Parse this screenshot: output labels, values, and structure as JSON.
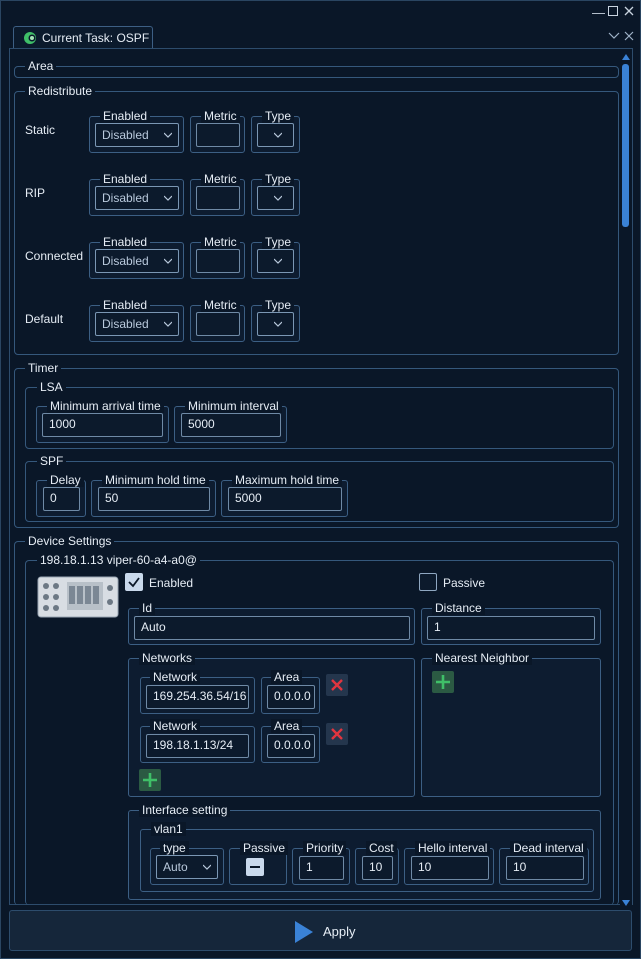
{
  "window": {
    "tab_title": "Current Task: OSPF"
  },
  "area": {
    "legend": "Area"
  },
  "redistribute": {
    "legend": "Redistribute",
    "col_enabled": "Enabled",
    "col_metric": "Metric",
    "col_type": "Type",
    "rows": [
      {
        "label": "Static",
        "enabled": "Disabled",
        "metric": "",
        "type": ""
      },
      {
        "label": "RIP",
        "enabled": "Disabled",
        "metric": "",
        "type": ""
      },
      {
        "label": "Connected",
        "enabled": "Disabled",
        "metric": "",
        "type": ""
      },
      {
        "label": "Default",
        "enabled": "Disabled",
        "metric": "",
        "type": ""
      }
    ]
  },
  "timer": {
    "legend": "Timer",
    "lsa": {
      "legend": "LSA",
      "min_arrival_label": "Minimum arrival time",
      "min_arrival_value": "1000",
      "min_interval_label": "Minimum interval",
      "min_interval_value": "5000"
    },
    "spf": {
      "legend": "SPF",
      "delay_label": "Delay",
      "delay_value": "0",
      "min_hold_label": "Minimum hold time",
      "min_hold_value": "50",
      "max_hold_label": "Maximum hold time",
      "max_hold_value": "5000"
    }
  },
  "device_settings": {
    "legend": "Device Settings",
    "device_title": "198.18.1.13 viper-60-a4-a0@",
    "enabled_label": "Enabled",
    "enabled_checked": true,
    "passive_label": "Passive",
    "passive_checked": false,
    "id_label": "Id",
    "id_value": "Auto",
    "distance_label": "Distance",
    "distance_value": "1",
    "networks": {
      "legend": "Networks",
      "network_label": "Network",
      "area_label": "Area",
      "items": [
        {
          "network": "169.254.36.54/16",
          "area": "0.0.0.0"
        },
        {
          "network": "198.18.1.13/24",
          "area": "0.0.0.0"
        }
      ]
    },
    "nearest_neighbor_label": "Nearest Neighbor",
    "interface_setting": {
      "legend": "Interface setting",
      "vlan_legend": "vlan1",
      "type_label": "type",
      "type_value": "Auto",
      "passive_label": "Passive",
      "priority_label": "Priority",
      "priority_value": "1",
      "cost_label": "Cost",
      "cost_value": "10",
      "hello_label": "Hello interval",
      "hello_value": "10",
      "dead_label": "Dead interval",
      "dead_value": "10"
    }
  },
  "apply_label": "Apply",
  "colors": {
    "background": "#0a1728",
    "accent": "#3a82d6",
    "delete": "#e0353f",
    "add": "#3fbf68"
  }
}
